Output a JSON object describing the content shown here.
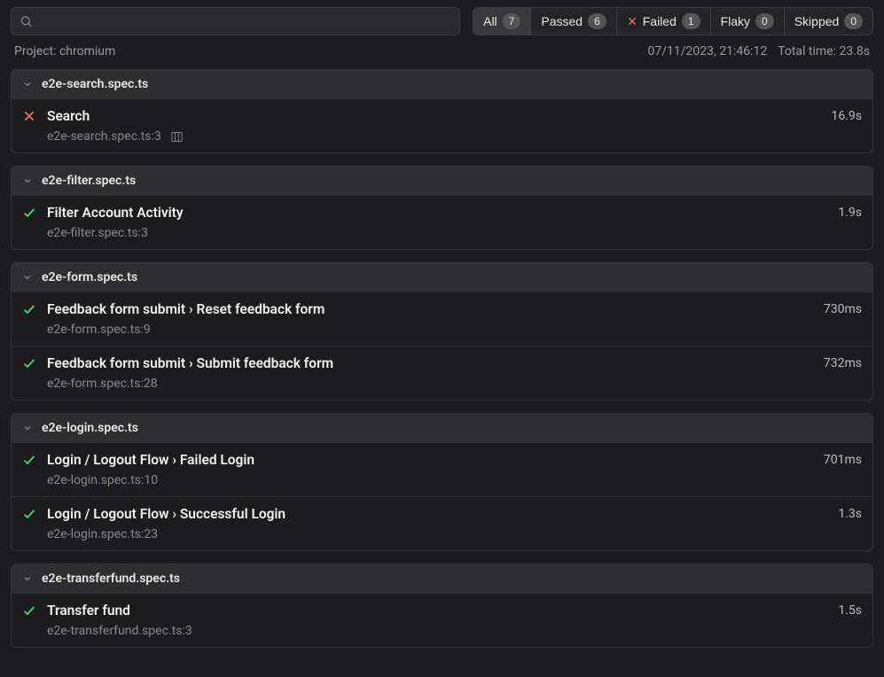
{
  "search": {
    "value": "",
    "placeholder": ""
  },
  "filters": [
    {
      "label": "All",
      "count": "7",
      "active": true,
      "icon": null
    },
    {
      "label": "Passed",
      "count": "6",
      "active": false,
      "icon": null
    },
    {
      "label": "Failed",
      "count": "1",
      "active": false,
      "icon": "fail"
    },
    {
      "label": "Flaky",
      "count": "0",
      "active": false,
      "icon": null
    },
    {
      "label": "Skipped",
      "count": "0",
      "active": false,
      "icon": null
    }
  ],
  "meta": {
    "project_label": "Project: chromium",
    "timestamp": "07/11/2023, 21:46:12",
    "total_time": "Total time: 23.8s"
  },
  "groups": [
    {
      "file": "e2e-search.spec.ts",
      "tests": [
        {
          "status": "fail",
          "name": "Search",
          "duration": "16.9s",
          "location": "e2e-search.spec.ts:3",
          "trace": true
        }
      ]
    },
    {
      "file": "e2e-filter.spec.ts",
      "tests": [
        {
          "status": "pass",
          "name": "Filter Account Activity",
          "duration": "1.9s",
          "location": "e2e-filter.spec.ts:3",
          "trace": false
        }
      ]
    },
    {
      "file": "e2e-form.spec.ts",
      "tests": [
        {
          "status": "pass",
          "name": "Feedback form submit › Reset feedback form",
          "duration": "730ms",
          "location": "e2e-form.spec.ts:9",
          "trace": false
        },
        {
          "status": "pass",
          "name": "Feedback form submit › Submit feedback form",
          "duration": "732ms",
          "location": "e2e-form.spec.ts:28",
          "trace": false
        }
      ]
    },
    {
      "file": "e2e-login.spec.ts",
      "tests": [
        {
          "status": "pass",
          "name": "Login / Logout Flow › Failed Login",
          "duration": "701ms",
          "location": "e2e-login.spec.ts:10",
          "trace": false
        },
        {
          "status": "pass",
          "name": "Login / Logout Flow › Successful Login",
          "duration": "1.3s",
          "location": "e2e-login.spec.ts:23",
          "trace": false
        }
      ]
    },
    {
      "file": "e2e-transferfund.spec.ts",
      "tests": [
        {
          "status": "pass",
          "name": "Transfer fund",
          "duration": "1.5s",
          "location": "e2e-transferfund.spec.ts:3",
          "trace": false
        }
      ]
    }
  ]
}
